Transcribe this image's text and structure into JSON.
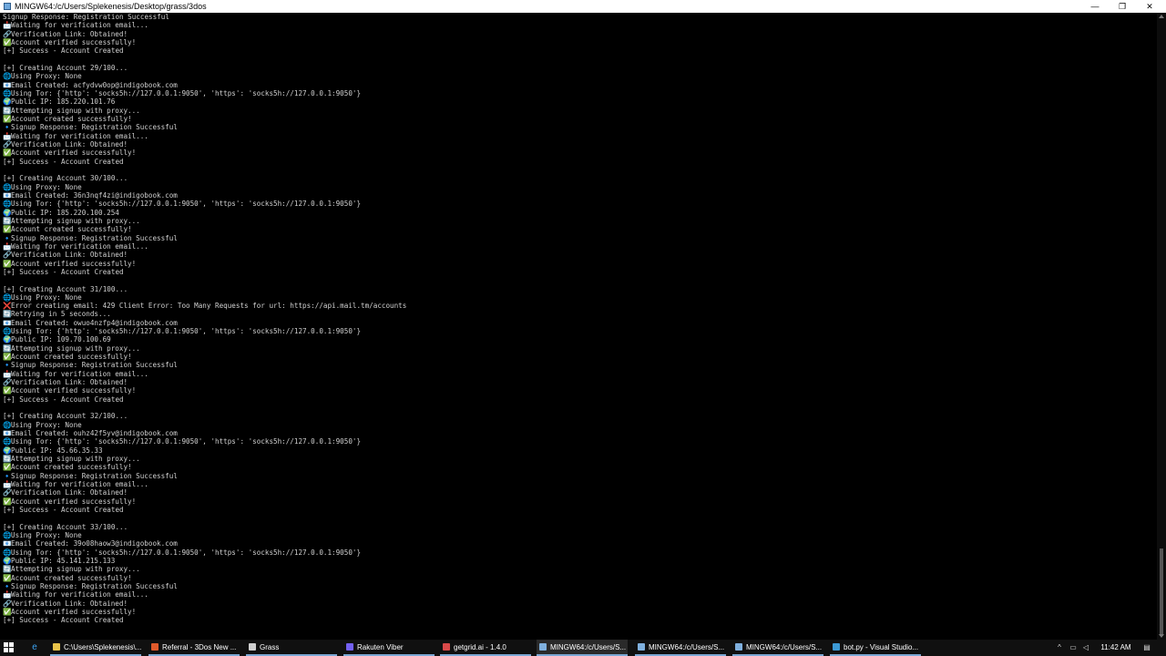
{
  "window": {
    "title": "MINGW64:/c/Users/Splekenesis/Desktop/grass/3dos",
    "minimize_glyph": "—",
    "maximize_glyph": "❐",
    "close_glyph": "✕"
  },
  "terminal": {
    "lines": [
      {
        "icon": "",
        "text": "Signup Response: Registration Successful"
      },
      {
        "icon": "📩",
        "text": "Waiting for verification email..."
      },
      {
        "icon": "🔗",
        "text": "Verification Link: Obtained!"
      },
      {
        "icon": "✅",
        "text": "Account verified successfully!"
      },
      {
        "icon": "",
        "text": "[+] Success - Account Created"
      },
      {
        "icon": "",
        "text": ""
      },
      {
        "icon": "",
        "text": "[+] Creating Account 29/100..."
      },
      {
        "icon": "🌐",
        "text": "Using Proxy: None"
      },
      {
        "icon": "📧",
        "text": "Email Created: acfydvw0op@indigobook.com"
      },
      {
        "icon": "🌐",
        "text": "Using Tor: {'http': 'socks5h://127.0.0.1:9050', 'https': 'socks5h://127.0.0.1:9050'}"
      },
      {
        "icon": "🌍",
        "text": "Public IP: 185.220.101.76"
      },
      {
        "icon": "🔄",
        "text": "Attempting signup with proxy..."
      },
      {
        "icon": "✅",
        "text": "Account created successfully!"
      },
      {
        "icon": "🔹",
        "text": "Signup Response: Registration Successful"
      },
      {
        "icon": "📩",
        "text": "Waiting for verification email..."
      },
      {
        "icon": "🔗",
        "text": "Verification Link: Obtained!"
      },
      {
        "icon": "✅",
        "text": "Account verified successfully!"
      },
      {
        "icon": "",
        "text": "[+] Success - Account Created"
      },
      {
        "icon": "",
        "text": ""
      },
      {
        "icon": "",
        "text": "[+] Creating Account 30/100..."
      },
      {
        "icon": "🌐",
        "text": "Using Proxy: None"
      },
      {
        "icon": "📧",
        "text": "Email Created: 36n3nqf4zi@indigobook.com"
      },
      {
        "icon": "🌐",
        "text": "Using Tor: {'http': 'socks5h://127.0.0.1:9050', 'https': 'socks5h://127.0.0.1:9050'}"
      },
      {
        "icon": "🌍",
        "text": "Public IP: 185.220.100.254"
      },
      {
        "icon": "🔄",
        "text": "Attempting signup with proxy..."
      },
      {
        "icon": "✅",
        "text": "Account created successfully!"
      },
      {
        "icon": "🔹",
        "text": "Signup Response: Registration Successful"
      },
      {
        "icon": "📩",
        "text": "Waiting for verification email..."
      },
      {
        "icon": "🔗",
        "text": "Verification Link: Obtained!"
      },
      {
        "icon": "✅",
        "text": "Account verified successfully!"
      },
      {
        "icon": "",
        "text": "[+] Success - Account Created"
      },
      {
        "icon": "",
        "text": ""
      },
      {
        "icon": "",
        "text": "[+] Creating Account 31/100..."
      },
      {
        "icon": "🌐",
        "text": "Using Proxy: None"
      },
      {
        "icon": "❌",
        "text": "Error creating email: 429 Client Error: Too Many Requests for url: https://api.mail.tm/accounts"
      },
      {
        "icon": "🔄",
        "text": "Retrying in 5 seconds..."
      },
      {
        "icon": "📧",
        "text": "Email Created: owuo4nzfp4@indigobook.com"
      },
      {
        "icon": "🌐",
        "text": "Using Tor: {'http': 'socks5h://127.0.0.1:9050', 'https': 'socks5h://127.0.0.1:9050'}"
      },
      {
        "icon": "🌍",
        "text": "Public IP: 109.70.100.69"
      },
      {
        "icon": "🔄",
        "text": "Attempting signup with proxy..."
      },
      {
        "icon": "✅",
        "text": "Account created successfully!"
      },
      {
        "icon": "🔹",
        "text": "Signup Response: Registration Successful"
      },
      {
        "icon": "📩",
        "text": "Waiting for verification email..."
      },
      {
        "icon": "🔗",
        "text": "Verification Link: Obtained!"
      },
      {
        "icon": "✅",
        "text": "Account verified successfully!"
      },
      {
        "icon": "",
        "text": "[+] Success - Account Created"
      },
      {
        "icon": "",
        "text": ""
      },
      {
        "icon": "",
        "text": "[+] Creating Account 32/100..."
      },
      {
        "icon": "🌐",
        "text": "Using Proxy: None"
      },
      {
        "icon": "📧",
        "text": "Email Created: ouhz42f5yv@indigobook.com"
      },
      {
        "icon": "🌐",
        "text": "Using Tor: {'http': 'socks5h://127.0.0.1:9050', 'https': 'socks5h://127.0.0.1:9050'}"
      },
      {
        "icon": "🌍",
        "text": "Public IP: 45.66.35.33"
      },
      {
        "icon": "🔄",
        "text": "Attempting signup with proxy..."
      },
      {
        "icon": "✅",
        "text": "Account created successfully!"
      },
      {
        "icon": "🔹",
        "text": "Signup Response: Registration Successful"
      },
      {
        "icon": "📩",
        "text": "Waiting for verification email..."
      },
      {
        "icon": "🔗",
        "text": "Verification Link: Obtained!"
      },
      {
        "icon": "✅",
        "text": "Account verified successfully!"
      },
      {
        "icon": "",
        "text": "[+] Success - Account Created"
      },
      {
        "icon": "",
        "text": ""
      },
      {
        "icon": "",
        "text": "[+] Creating Account 33/100..."
      },
      {
        "icon": "🌐",
        "text": "Using Proxy: None"
      },
      {
        "icon": "📧",
        "text": "Email Created: 39o08haow3@indigobook.com"
      },
      {
        "icon": "🌐",
        "text": "Using Tor: {'http': 'socks5h://127.0.0.1:9050', 'https': 'socks5h://127.0.0.1:9050'}"
      },
      {
        "icon": "🌍",
        "text": "Public IP: 45.141.215.133"
      },
      {
        "icon": "🔄",
        "text": "Attempting signup with proxy..."
      },
      {
        "icon": "✅",
        "text": "Account created successfully!"
      },
      {
        "icon": "🔹",
        "text": "Signup Response: Registration Successful"
      },
      {
        "icon": "📩",
        "text": "Waiting for verification email..."
      },
      {
        "icon": "🔗",
        "text": "Verification Link: Obtained!"
      },
      {
        "icon": "✅",
        "text": "Account verified successfully!"
      },
      {
        "icon": "",
        "text": "[+] Success - Account Created"
      }
    ]
  },
  "taskbar": {
    "tasks": [
      {
        "label": "C:\\Users\\Splekenesis\\...",
        "icon_color": "#e8c34a",
        "active": false
      },
      {
        "label": "Referral - 3Dos New ...",
        "icon_color": "#e05a2b",
        "active": false
      },
      {
        "label": "Grass",
        "icon_color": "#cfcfcf",
        "active": false
      },
      {
        "label": "Rakuten Viber",
        "icon_color": "#7360f2",
        "active": false
      },
      {
        "label": "getgrid.ai - 1.4.0",
        "icon_color": "#d94a4a",
        "active": false
      },
      {
        "label": "MINGW64:/c/Users/S...",
        "icon_color": "#7fb0de",
        "active": true
      },
      {
        "label": "MINGW64:/c/Users/S...",
        "icon_color": "#7fb0de",
        "active": false
      },
      {
        "label": "MINGW64:/c/Users/S...",
        "icon_color": "#7fb0de",
        "active": false
      },
      {
        "label": "bot.py - Visual Studio...",
        "icon_color": "#3c99d4",
        "active": false
      }
    ],
    "tray": {
      "chevron": "^",
      "time": "11:42 AM"
    }
  }
}
